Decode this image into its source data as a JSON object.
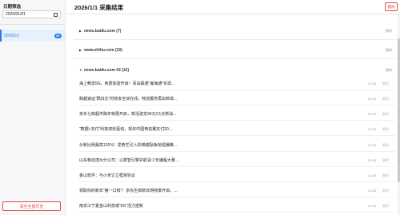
{
  "sidebar": {
    "filter_label": "日期筛选",
    "date_value": "2026/01/01",
    "date_item": {
      "label": "2026/1/1",
      "count": "29"
    },
    "clear_label": "清空全部历史"
  },
  "main": {
    "title": "2026/1/1 采集结果",
    "delete_label": "删除"
  },
  "groups": [
    {
      "title": "news.baidu.com (7)",
      "expanded": false,
      "delete": "删除"
    },
    {
      "title": "www.zhihu.com (10)",
      "expanded": false,
      "delete": "删除"
    },
    {
      "title": "news.baidu.com #2 (12)",
      "expanded": true,
      "delete": "删除"
    }
  ],
  "rows": [
    {
      "title": "海上畅享5G，免费体验开启！青岛联通“瀚海通”实现...",
      "time": "21:05",
      "delete": "删除"
    },
    {
      "title": "跨越速运“隔日达”时效安全双在线，物流服务再出新高...",
      "time": "21:05",
      "delete": "删除"
    },
    {
      "title": "京东七鲜超市跨年特惠开启，鲜活波龙99元/只点燃消...",
      "time": "21:05",
      "delete": "删除"
    },
    {
      "title": "“数据+支付”科技双轮驱动，现年中国电信翼支付20...",
      "time": "21:05",
      "delete": "删除"
    },
    {
      "title": "分账比例最高120%！爱奇艺引入阶梯激励争抢短播精...",
      "time": "21:05",
      "delete": "删除"
    },
    {
      "title": "山东移动滨州分公司：以数智引擎护航青少年编程大赛 ...",
      "time": "21:05",
      "delete": "删除"
    },
    {
      "title": "金山软件：与小米订立框架协议",
      "time": "21:05",
      "delete": "删除"
    },
    {
      "title": "领取你的新年“第一口鲜”！京东生鲜新年购物季开启，...",
      "time": "21:05",
      "delete": "删除"
    },
    {
      "title": "南京江宁夏金山科技城“6G”活力迸新",
      "time": "21:05",
      "delete": "删除"
    }
  ]
}
